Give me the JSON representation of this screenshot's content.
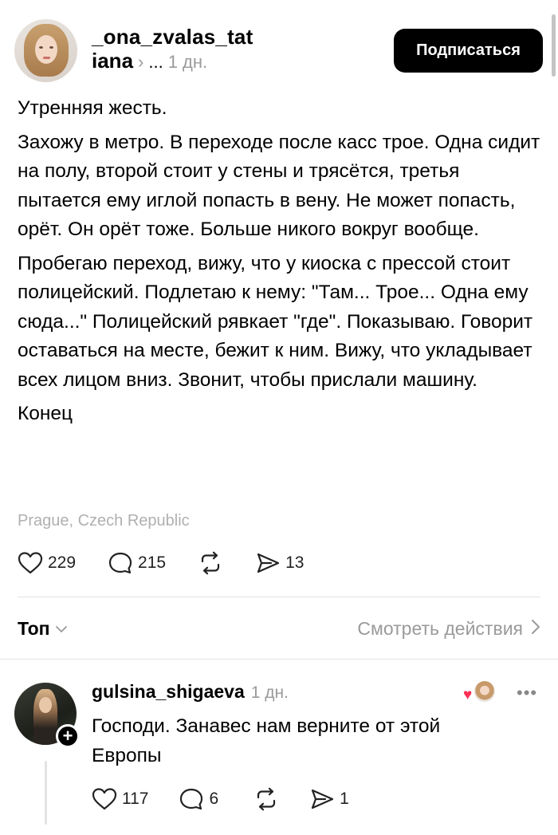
{
  "post": {
    "username": "_ona_zvalas_tat",
    "display_name": "iana",
    "meta_chevron": "›",
    "meta_dots": "...",
    "time": "1 дн.",
    "follow_label": "Подписаться",
    "paragraphs": [
      "Утренняя жесть.",
      "Захожу в метро. В переходе после касс трое. Одна сидит на полу, второй стоит у стены и трясётся, третья пытается ему иглой попасть в вену. Не может попасть, орёт. Он орёт тоже. Больше никого вокруг вообще.",
      "Пробегаю переход, вижу, что у киоска с прессой стоит полицейский. Подлетаю к нему: \"Там... Трое... Одна ему сюда...\" Полицейский рявкает \"где\". Показываю. Говорит оставаться на месте, бежит к ним. Вижу, что укладывает всех лицом вниз. Звонит, чтобы прислали машину.",
      "Конец"
    ],
    "location": "Prague, Czech Republic",
    "likes": "229",
    "comments": "215",
    "shares": "13"
  },
  "sort": {
    "label": "Топ",
    "activity_label": "Смотреть действия"
  },
  "comment": {
    "username": "gulsina_shigaeva",
    "time": "1 дн.",
    "text": "Господи. Занавес нам верните от этой Европы",
    "likes": "117",
    "replies": "6",
    "shares": "1",
    "more": "•••"
  },
  "icons": {
    "like": "heart-icon",
    "comment": "speech-bubble-icon",
    "repost": "repost-icon",
    "send": "send-icon",
    "follow_badge": "plus-icon"
  },
  "colors": {
    "accent_heart": "#ff2f55",
    "muted_text": "#9a9a9a",
    "button_bg": "#000000"
  }
}
